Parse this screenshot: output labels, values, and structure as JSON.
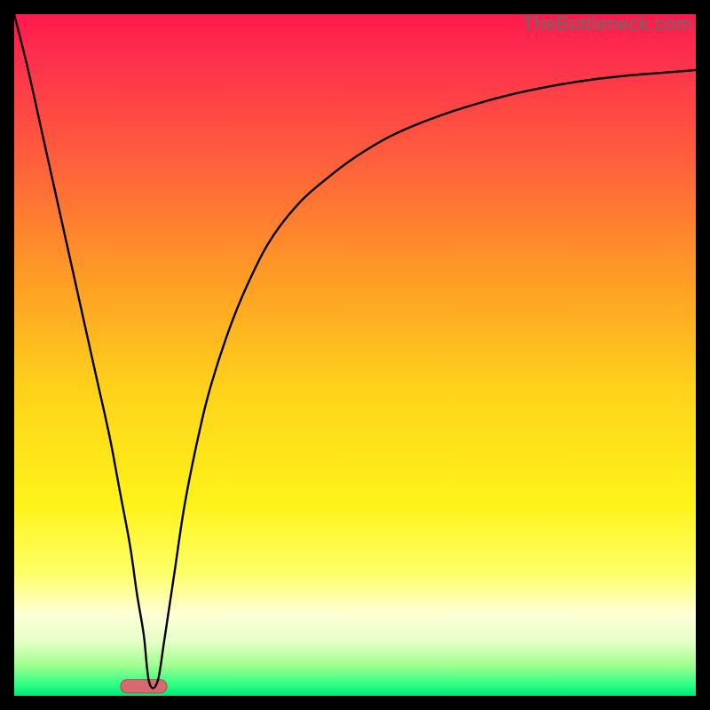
{
  "watermark": "TheBottleneck.com",
  "chart_data": {
    "type": "line",
    "title": "",
    "xlabel": "",
    "ylabel": "",
    "xlim": [
      0,
      100
    ],
    "ylim": [
      0,
      100
    ],
    "background_gradient": {
      "stops": [
        {
          "offset": 0.0,
          "color": "#ff1a4d"
        },
        {
          "offset": 0.06,
          "color": "#ff2e4d"
        },
        {
          "offset": 0.2,
          "color": "#ff5a3d"
        },
        {
          "offset": 0.38,
          "color": "#ff9a26"
        },
        {
          "offset": 0.55,
          "color": "#ffd21a"
        },
        {
          "offset": 0.72,
          "color": "#fff31a"
        },
        {
          "offset": 0.82,
          "color": "#ffff68"
        },
        {
          "offset": 0.88,
          "color": "#ffffd6"
        },
        {
          "offset": 0.92,
          "color": "#e4ffc8"
        },
        {
          "offset": 0.955,
          "color": "#a0ff90"
        },
        {
          "offset": 0.985,
          "color": "#28ff84"
        },
        {
          "offset": 1.0,
          "color": "#00e676"
        }
      ]
    },
    "series": [
      {
        "name": "bottleneck-curve",
        "color": "#000000",
        "width": 2.4,
        "x": [
          0,
          2,
          4,
          6,
          8,
          10,
          12,
          14,
          15.5,
          17,
          18,
          19,
          19.8,
          21,
          22,
          23.5,
          25,
          27,
          29,
          32,
          35,
          38,
          42,
          46,
          50,
          55,
          60,
          66,
          72,
          78,
          84,
          90,
          95,
          100
        ],
        "y": [
          100,
          92,
          83,
          74,
          65,
          56,
          47,
          38,
          30,
          22,
          15,
          9,
          2,
          2,
          8,
          18,
          28,
          38,
          46,
          55,
          62,
          67.5,
          72.5,
          76,
          79,
          82,
          84.2,
          86.3,
          88,
          89.3,
          90.3,
          91,
          91.4,
          91.8
        ]
      }
    ],
    "marker": {
      "name": "optimal-point",
      "shape": "pill",
      "x_center": 19.0,
      "y_center": 1.4,
      "width": 6.8,
      "height": 2.0,
      "fill": "#d86a6f",
      "stroke": "#b14a4f"
    }
  }
}
